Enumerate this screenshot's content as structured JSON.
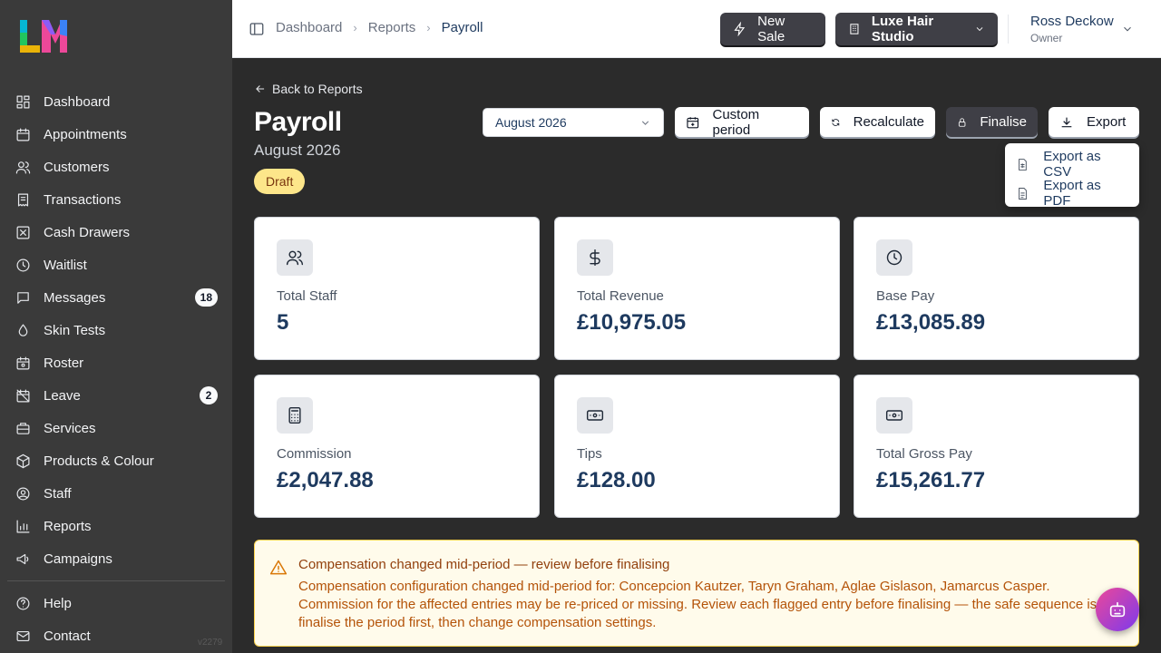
{
  "sidebar": {
    "logo": "LM",
    "items": [
      {
        "label": "Dashboard",
        "icon": "dashboard-icon"
      },
      {
        "label": "Appointments",
        "icon": "calendar-icon"
      },
      {
        "label": "Customers",
        "icon": "users-icon"
      },
      {
        "label": "Transactions",
        "icon": "receipt-icon"
      },
      {
        "label": "Cash Drawers",
        "icon": "cash-drawer-icon"
      },
      {
        "label": "Waitlist",
        "icon": "clock-icon"
      },
      {
        "label": "Messages",
        "icon": "message-icon",
        "badge": "18"
      },
      {
        "label": "Skin Tests",
        "icon": "droplet-icon"
      },
      {
        "label": "Roster",
        "icon": "roster-icon"
      },
      {
        "label": "Leave",
        "icon": "calendar-off-icon",
        "badge": "2"
      },
      {
        "label": "Services",
        "icon": "briefcase-icon"
      },
      {
        "label": "Products & Colour",
        "icon": "package-icon"
      },
      {
        "label": "Staff",
        "icon": "user-circle-icon"
      },
      {
        "label": "Reports",
        "icon": "bar-chart-icon"
      },
      {
        "label": "Campaigns",
        "icon": "megaphone-icon"
      }
    ],
    "footer_items": [
      {
        "label": "Help",
        "icon": "help-icon"
      },
      {
        "label": "Contact",
        "icon": "mail-icon"
      }
    ],
    "version": "v2279"
  },
  "topbar": {
    "breadcrumbs": [
      "Dashboard",
      "Reports",
      "Payroll"
    ],
    "new_sale_label": "New Sale",
    "studio_label": "Luxe Hair Studio",
    "user_name": "Ross Deckow",
    "user_role": "Owner"
  },
  "page": {
    "back_label": "Back to Reports",
    "title": "Payroll",
    "subtitle": "August 2026",
    "status": "Draft",
    "period_select": "August 2026",
    "custom_period_label": "Custom period",
    "recalculate_label": "Recalculate",
    "finalise_label": "Finalise",
    "export_label": "Export",
    "export_menu": [
      "Export as CSV",
      "Export as PDF"
    ]
  },
  "stats": [
    {
      "label": "Total Staff",
      "value": "5",
      "icon": "users-icon"
    },
    {
      "label": "Total Revenue",
      "value": "£10,975.05",
      "icon": "dollar-icon"
    },
    {
      "label": "Base Pay",
      "value": "£13,085.89",
      "icon": "clock-icon"
    },
    {
      "label": "Commission",
      "value": "£2,047.88",
      "icon": "calculator-icon"
    },
    {
      "label": "Tips",
      "value": "£128.00",
      "icon": "banknote-icon"
    },
    {
      "label": "Total Gross Pay",
      "value": "£15,261.77",
      "icon": "banknote-icon"
    }
  ],
  "alert": {
    "title": "Compensation changed mid-period — review before finalising",
    "body": "Compensation configuration changed mid-period for: Concepcion Kautzer, Taryn Graham, Aglae Gislason, Jamarcus Casper. Commission for the affected entries may be re-priced or missing. Review each flagged entry before finalising — the safe sequence is to finalise the period first, then change compensation settings."
  },
  "colors": {
    "sidebar_bg": "#3a3a3a",
    "main_bg": "#2b2b2b",
    "accent_navy": "#1e3a5f",
    "draft_badge": "#fde68a",
    "warning_bg": "#fffbeb"
  }
}
